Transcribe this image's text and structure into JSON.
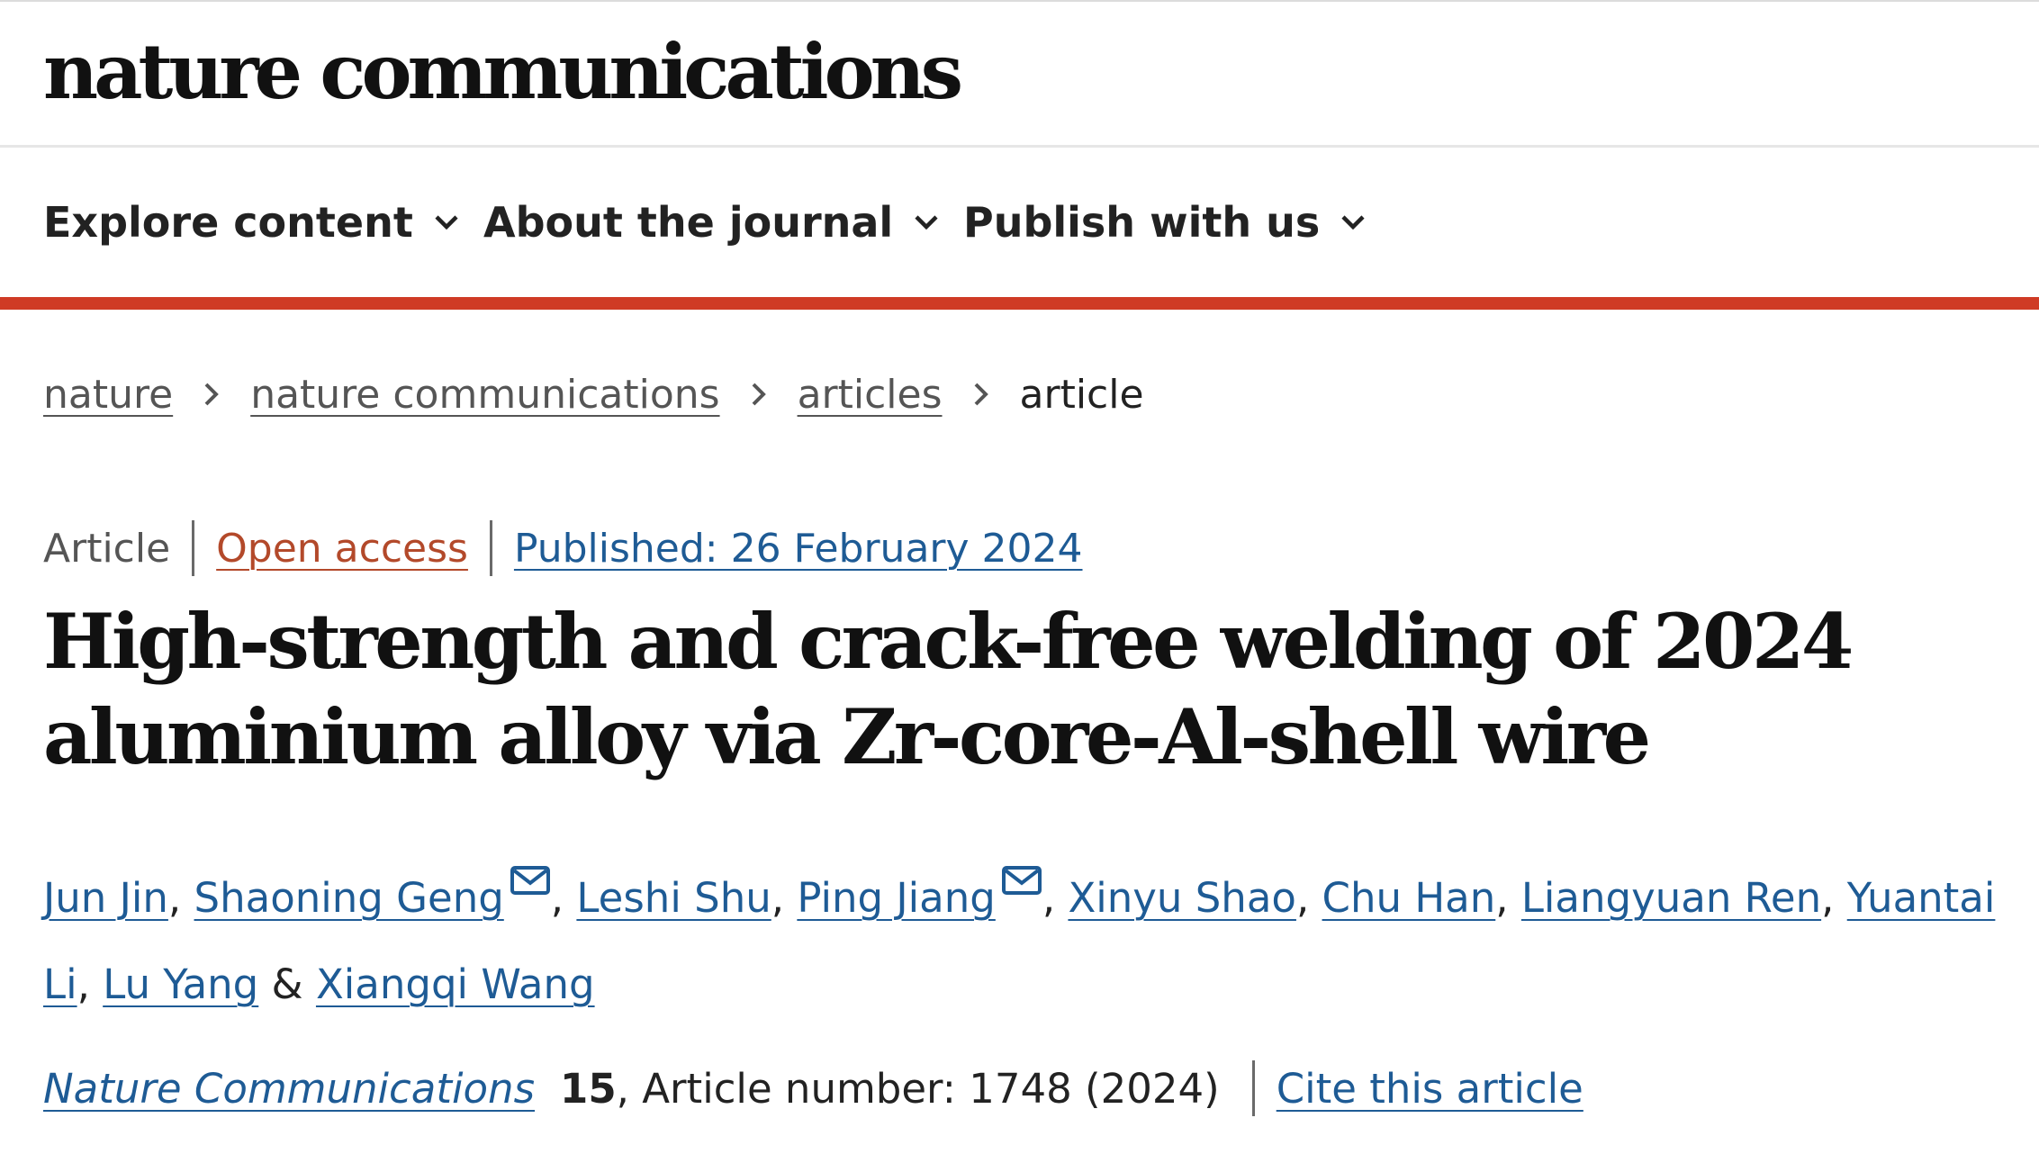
{
  "header": {
    "logo": "nature communications"
  },
  "nav": {
    "items": [
      {
        "label": "Explore content"
      },
      {
        "label": "About the journal"
      },
      {
        "label": "Publish with us"
      }
    ]
  },
  "breadcrumb": {
    "items": [
      {
        "label": "nature"
      },
      {
        "label": "nature communications"
      },
      {
        "label": "articles"
      }
    ],
    "current": "article"
  },
  "article_meta": {
    "type": "Article",
    "access": "Open access",
    "published": "Published: 26 February 2024"
  },
  "title": "High-strength and crack-free welding of 2024 aluminium alloy via Zr-core-Al-shell wire",
  "authors": {
    "list": [
      {
        "name": "Jun Jin",
        "sep": ", "
      },
      {
        "name": "Shaoning Geng",
        "sep": ", ",
        "icon": "mail-icon"
      },
      {
        "name": "Leshi Shu",
        "sep": ", "
      },
      {
        "name": "Ping Jiang",
        "sep": ", ",
        "icon": "mail-icon"
      },
      {
        "name": "Xinyu Shao",
        "sep": ", "
      },
      {
        "name": "Chu Han",
        "sep": ", "
      },
      {
        "name": "Liangyuan Ren",
        "sep": ", "
      },
      {
        "name": "Yuantai Li",
        "sep": ", "
      },
      {
        "name": "Lu Yang",
        "sep": " & "
      },
      {
        "name": "Xiangqi Wang",
        "sep": ""
      }
    ]
  },
  "citation": {
    "journal": "Nature Communications",
    "volume": "15",
    "details": ", Article number: 1748 (2024)",
    "cite_label": "Cite this article"
  },
  "colors": {
    "accent_bar": "#cf3b25",
    "link": "#1e5b95",
    "open_access": "#b3492a"
  }
}
